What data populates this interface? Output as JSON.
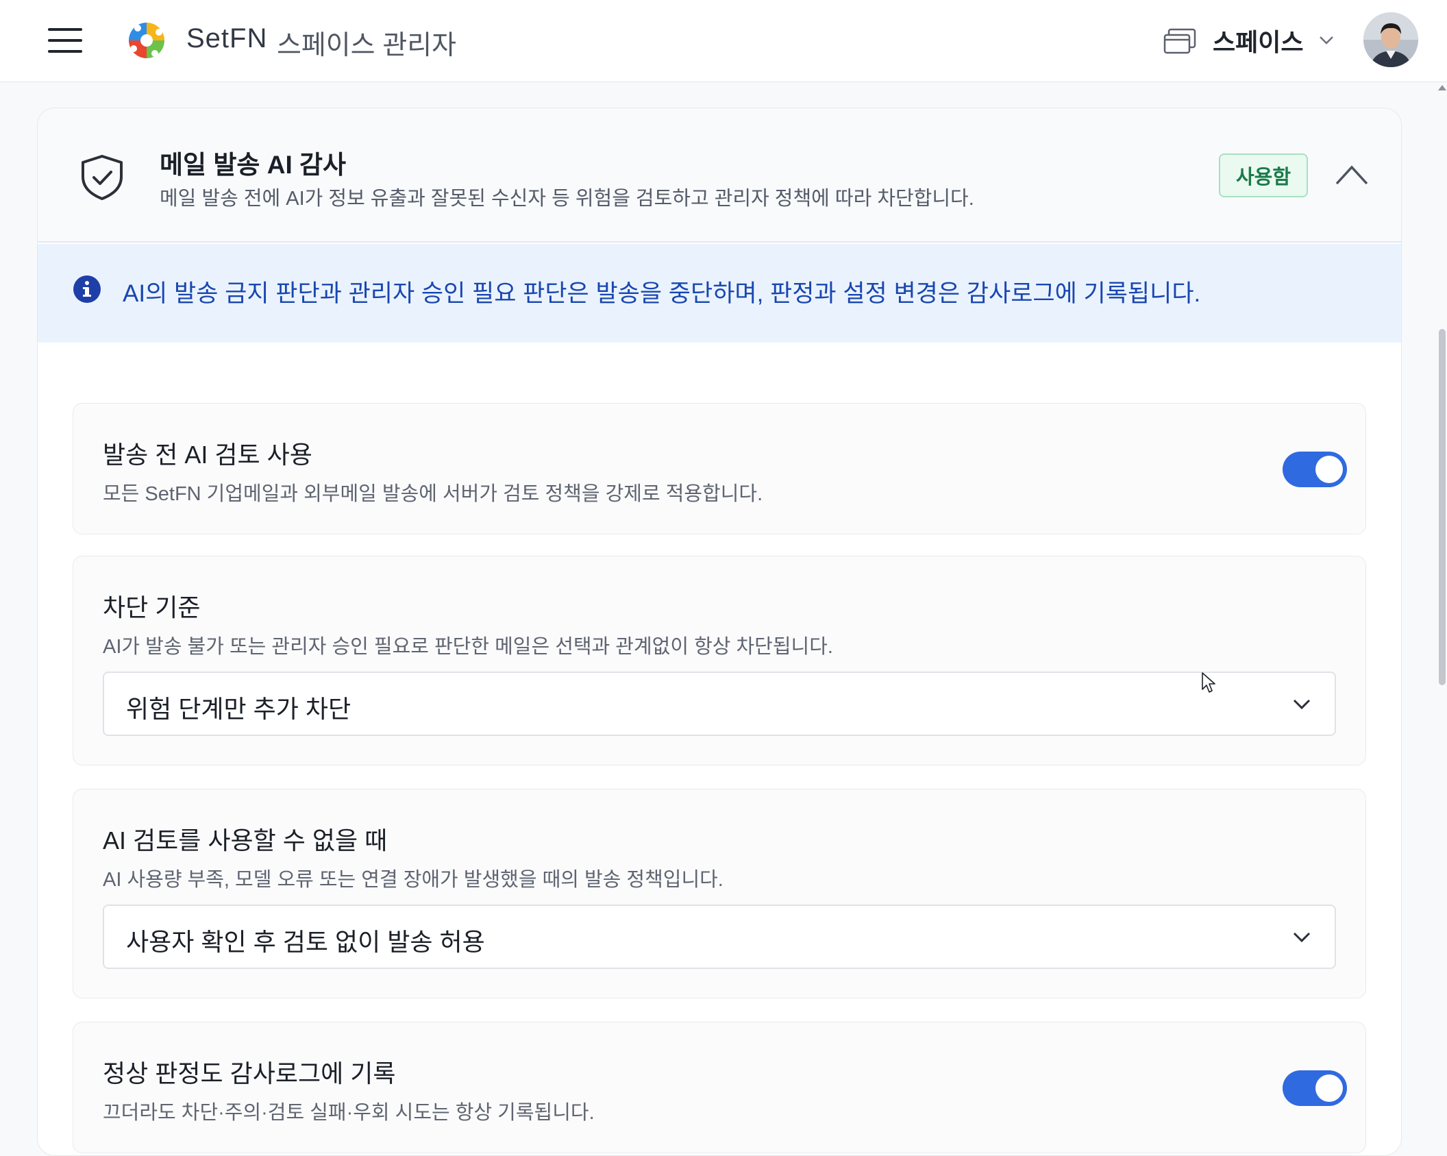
{
  "header": {
    "brand_name": "SetFN",
    "subtitle": "스페이스 관리자",
    "space_label": "스페이스"
  },
  "audit": {
    "title": "메일 발송 AI 감사",
    "description": "메일 발송 전에 AI가 정보 유출과 잘못된 수신자 등 위험을 검토하고 관리자 정책에 따라 차단합니다.",
    "status": "사용함",
    "status_color": "#1b7a4a",
    "info": "AI의 발송 금지 판단과 관리자 승인 필요 판단은 발송을 중단하며, 판정과 설정 변경은 감사로그에 기록됩니다."
  },
  "settings": {
    "pre_review": {
      "title": "발송 전 AI 검토 사용",
      "description": "모든 SetFN 기업메일과 외부메일 발송에 서버가 검토 정책을 강제로 적용합니다.",
      "enabled": true
    },
    "block_criteria": {
      "title": "차단 기준",
      "description": "AI가 발송 불가 또는 관리자 승인 필요로 판단한 메일은 선택과 관계없이 항상 차단됩니다.",
      "selected": "위험 단계만 추가 차단"
    },
    "unavailable": {
      "title": "AI 검토를 사용할 수 없을 때",
      "description": "AI 사용량 부족, 모델 오류 또는 연결 장애가 발생했을 때의 발송 정책입니다.",
      "selected": "사용자 확인 후 검토 없이 발송 허용"
    },
    "log_normal": {
      "title": "정상 판정도 감사로그에 기록",
      "description": "끄더라도 차단·주의·검토 실패·우회 시도는 항상 기록됩니다.",
      "enabled": true
    }
  },
  "colors": {
    "accent": "#2f6ae0",
    "info_text": "#1946b0",
    "info_background": "#eaf3fd"
  }
}
